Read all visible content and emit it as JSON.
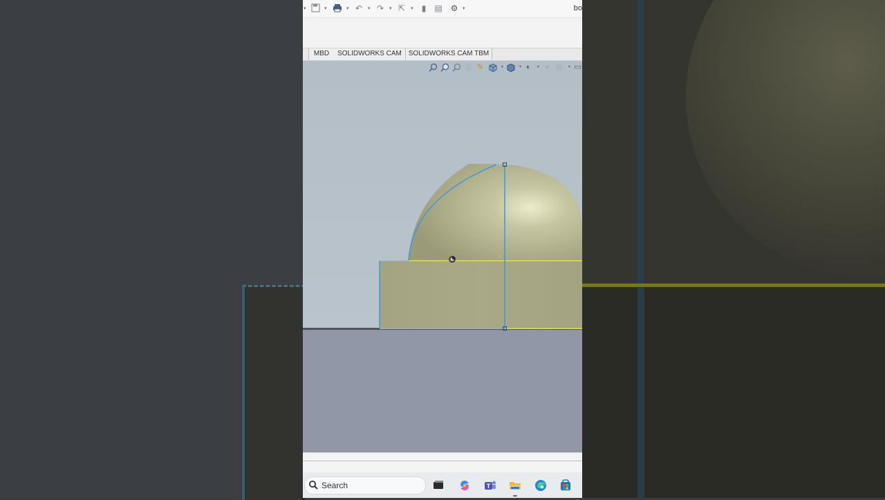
{
  "app": {
    "document_title": "bo"
  },
  "tabs": [
    "MBD",
    "SOLIDWORKS CAM",
    "SOLIDWORKS CAM TBM"
  ],
  "taskbar": {
    "search_placeholder": "Search"
  },
  "quick_access_icons": [
    "save-icon",
    "print-icon",
    "undo-icon",
    "redo-icon",
    "select-icon",
    "rebuild-icon",
    "file-properties-icon",
    "options-icon"
  ],
  "view_toolbar_icons": [
    "zoom-to-fit-icon",
    "zoom-to-area-icon",
    "previous-view-icon",
    "section-view-icon",
    "dynamic-annotation-icon",
    "view-orientation-icon",
    "display-style-icon",
    "hide-show-icon",
    "edit-appearance-icon",
    "apply-scene-icon",
    "view-settings-icon"
  ],
  "taskbar_icons": [
    "task-view-icon",
    "copilot-icon",
    "teams-icon",
    "file-explorer-icon",
    "edge-icon",
    "store-icon"
  ],
  "colors": {
    "sketch_blue": "#4aa3df",
    "sketch_yellow": "#e8e82a",
    "model_green": "#a9a984",
    "floor": "#9297a8"
  }
}
